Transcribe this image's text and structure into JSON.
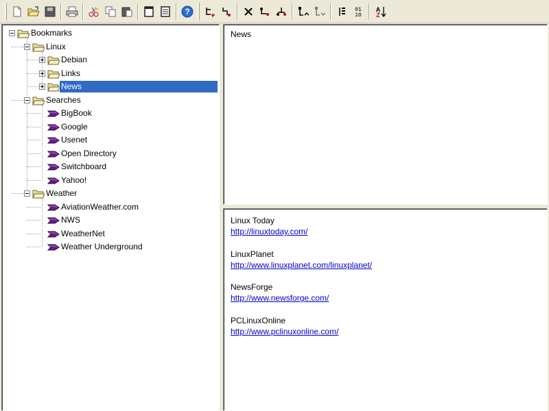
{
  "toolbar": {
    "buttons": [
      {
        "icon": "new-document-icon"
      },
      {
        "icon": "open-folder-icon"
      },
      {
        "icon": "save-icon"
      },
      {
        "icon": "print-icon"
      },
      {
        "icon": "cut-icon"
      },
      {
        "icon": "copy-icon"
      },
      {
        "icon": "paste-icon"
      },
      {
        "icon": "view-single-pane-icon"
      },
      {
        "icon": "view-details-icon"
      },
      {
        "icon": "help-icon"
      },
      {
        "icon": "add-node-icon"
      },
      {
        "icon": "add-child-node-icon"
      },
      {
        "icon": "delete-icon"
      },
      {
        "icon": "move-down-icon"
      },
      {
        "icon": "move-up-icon"
      },
      {
        "icon": "promote-icon"
      },
      {
        "icon": "demote-icon"
      },
      {
        "icon": "number-outline-icon"
      },
      {
        "icon": "binary-numbering-icon"
      },
      {
        "icon": "sort-az-icon"
      }
    ],
    "sort_label": "AZ",
    "binary_label_top": "01",
    "binary_label_bottom": "10"
  },
  "tree": {
    "root": "Bookmarks",
    "linux": {
      "label": "Linux",
      "children": [
        "Debian",
        "Links",
        "News"
      ]
    },
    "searches": {
      "label": "Searches",
      "children": [
        "BigBook",
        "Google",
        "Usenet",
        "Open Directory",
        "Switchboard",
        "Yahoo!"
      ]
    },
    "weather": {
      "label": "Weather",
      "children": [
        "AviationWeather.com",
        "NWS",
        "WeatherNet",
        "Weather Underground"
      ]
    },
    "selected": "News"
  },
  "title_pane": {
    "title": "News"
  },
  "list_pane": {
    "entries": [
      {
        "name": "Linux Today",
        "url": "http://linuxtoday.com/"
      },
      {
        "name": "LinuxPlanet",
        "url": "http://www.linuxplanet.com/linuxplanet/"
      },
      {
        "name": "NewsForge",
        "url": "http://www.newsforge.com/"
      },
      {
        "name": "PCLinuxOnline",
        "url": "http://www.pclinuxonline.com/"
      }
    ]
  },
  "colors": {
    "selection": "#316ac5",
    "link": "#0000cc",
    "folder": "#f3e3a3",
    "bookmark_arrow": "#6a1a8a"
  }
}
